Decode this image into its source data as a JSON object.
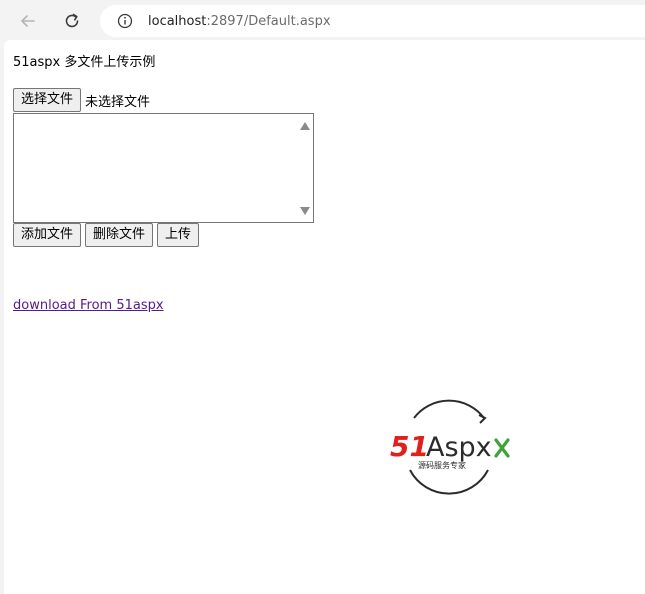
{
  "browser": {
    "url_host": "localhost",
    "url_rest": ":2897/Default.aspx"
  },
  "page": {
    "title": "51aspx 多文件上传示例",
    "choose_file_label": "选择文件",
    "no_file_label": "未选择文件",
    "add_file_label": "添加文件",
    "delete_file_label": "删除文件",
    "upload_label": "上传",
    "download_link": "download From 51aspx"
  },
  "logo": {
    "brand_51": "51",
    "brand_aspx": "Aspx",
    "tagline": "源码服务专家",
    "colors": {
      "red": "#e0201c",
      "dark": "#2b2b2b",
      "green": "#3ea33b"
    }
  }
}
